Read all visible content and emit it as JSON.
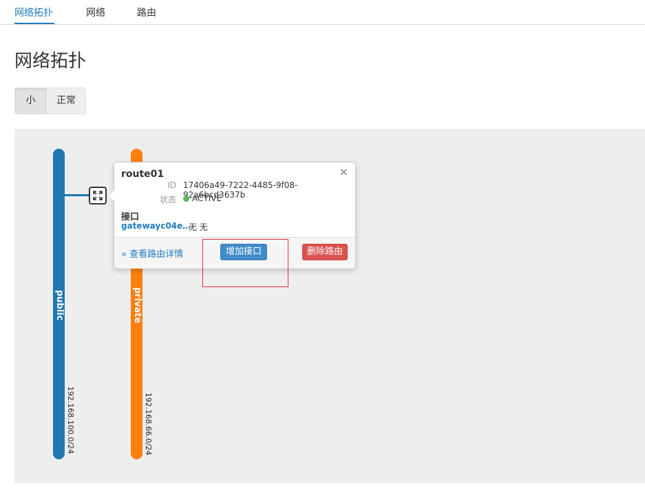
{
  "tabs": [
    {
      "label": "网络拓扑"
    },
    {
      "label": "网络"
    },
    {
      "label": "路由"
    }
  ],
  "page_title": "网络拓扑",
  "size_toggle": {
    "small": "小",
    "normal": "正常"
  },
  "networks": [
    {
      "name": "public",
      "cidr": "192.168.100.0/24",
      "color": "#1f77b4"
    },
    {
      "name": "private",
      "cidr": "192.168.66.0/24",
      "color": "#ff7f0e"
    }
  ],
  "router_popover": {
    "title": "route01",
    "close": "×",
    "id_label": "ID",
    "id_value": "17406a49-7222-4485-9f08-92a6bcd3637b",
    "status_label": "状态",
    "status_value": "ACTIVE",
    "status_color": "#5cb85c",
    "interfaces_title": "接口",
    "interface_name": "gatewayc04e…",
    "interface_value": "无 无",
    "view_details": "» 查看路由详情",
    "add_interface": "增加接口",
    "delete_router": "删除路由"
  }
}
